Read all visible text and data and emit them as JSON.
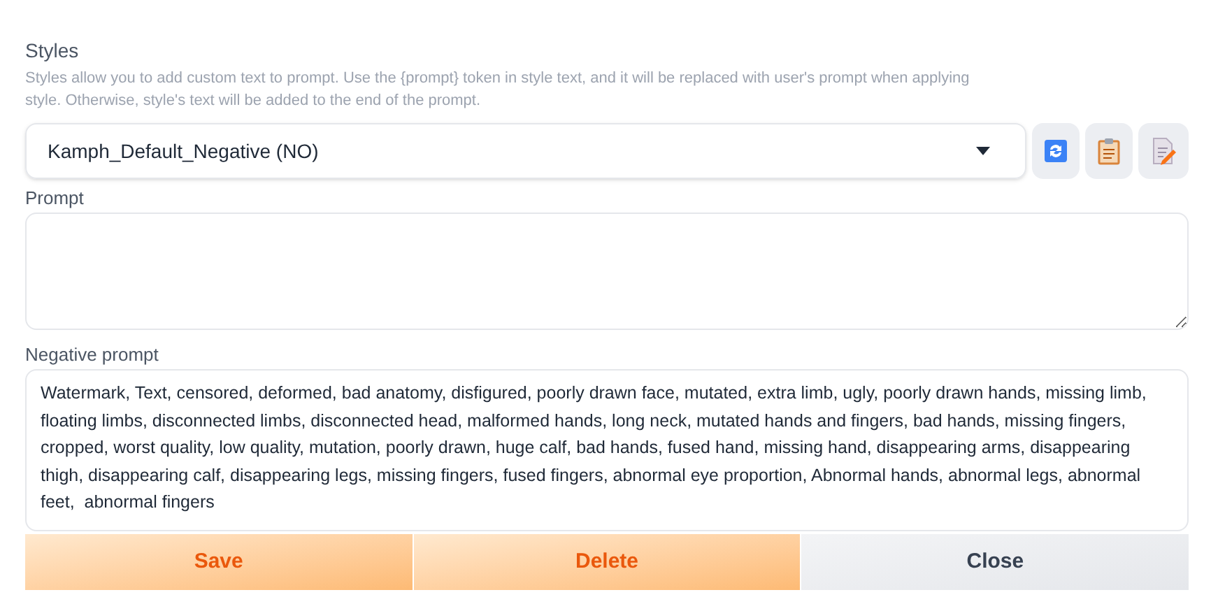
{
  "styles": {
    "label": "Styles",
    "description": "Styles allow you to add custom text to prompt. Use the {prompt} token in style text, and it will be replaced with user's prompt when applying style. Otherwise, style's text will be added to the end of the prompt.",
    "selected_style": "Kamph_Default_Negative (NO)"
  },
  "prompt": {
    "label": "Prompt"
  },
  "negative_prompt": {
    "label": "Negative prompt",
    "value": "Watermark, Text, censored, deformed, bad anatomy, disfigured, poorly drawn face, mutated, extra limb, ugly, poorly drawn hands, missing limb, floating limbs, disconnected limbs, disconnected head, malformed hands, long neck, mutated hands and fingers, bad hands, missing fingers, cropped, worst quality, low quality, mutation, poorly drawn, huge calf, bad hands, fused hand, missing hand, disappearing arms, disappearing thigh, disappearing calf, disappearing legs, missing fingers, fused fingers, abnormal eye proportion, Abnormal hands, abnormal legs, abnormal feet,  abnormal fingers"
  },
  "buttons": [
    {
      "label": "Save",
      "kind": "primary"
    },
    {
      "label": "Delete",
      "kind": "primary"
    },
    {
      "label": "Close",
      "kind": "secondary"
    }
  ]
}
